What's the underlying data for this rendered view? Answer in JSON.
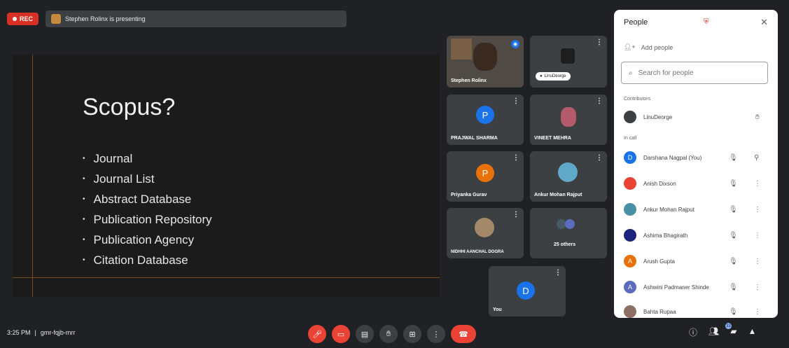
{
  "top_bar": {
    "rec_label": "REC",
    "presenter_text": "Stephen Rolinx is presenting"
  },
  "slide": {
    "title": "Scopus?",
    "bullets": [
      "Journal",
      "Journal List",
      "Abstract Database",
      "Publication Repository",
      "Publication Agency",
      "Citation Database"
    ]
  },
  "tiles": [
    {
      "name": "Stephen Rolinx",
      "avatar": "",
      "color": ""
    },
    {
      "name": "",
      "avatar": "",
      "color": "",
      "mic_label": "LinuDeorge"
    },
    {
      "name": "PRAJWAL SHARMA",
      "avatar": "P",
      "color": "#1a73e8"
    },
    {
      "name": "VINEET MEHRA",
      "avatar": "",
      "color": ""
    },
    {
      "name": "Priyanka Gurav",
      "avatar": "P",
      "color": "#e8710a"
    },
    {
      "name": "Ankur Mohan Rajput",
      "avatar": "",
      "color": ""
    },
    {
      "name": "NIDHHI AANCHAL DOGRA",
      "avatar": "",
      "color": ""
    },
    {
      "name": "25 others",
      "avatar": "",
      "color": ""
    },
    {
      "name": "You",
      "avatar": "D",
      "color": "#1a73e8"
    }
  ],
  "bottom_bar": {
    "time": "3:25 PM",
    "meeting_code": "gmr-fqjb-mrr",
    "people_badge": "33"
  },
  "people_panel": {
    "title": "People",
    "add_people": "Add people",
    "search_placeholder": "Search for people",
    "section_contributors": "Contributors",
    "section_in_call": "In call",
    "host": {
      "name": "LinuDeorge",
      "avatar": "",
      "color": "#3c4043"
    },
    "participants": [
      {
        "name": "Darshana Nagpal (You)",
        "avatar": "D",
        "color": "#1a73e8"
      },
      {
        "name": "Anish Dixson",
        "avatar": "",
        "color": "#ea4335"
      },
      {
        "name": "Ankur Mohan Rajput",
        "avatar": "",
        "color": "#4a90a4"
      },
      {
        "name": "Ashima Bhagirath",
        "avatar": "",
        "color": "#1a237e"
      },
      {
        "name": "Arush Gupta",
        "avatar": "A",
        "color": "#e8710a"
      },
      {
        "name": "Ashwini Padmaner Shinde",
        "avatar": "A",
        "color": "#5c6bc0"
      },
      {
        "name": "Bahta Rupaa",
        "avatar": "",
        "color": "#8d6e63"
      }
    ]
  },
  "icons": {
    "mic": "mic-icon",
    "camera": "camera-icon",
    "captions": "captions-icon",
    "raise_hand": "raise-hand-icon",
    "present": "present-icon",
    "more": "more-options-icon",
    "end_call": "end-call-icon"
  }
}
